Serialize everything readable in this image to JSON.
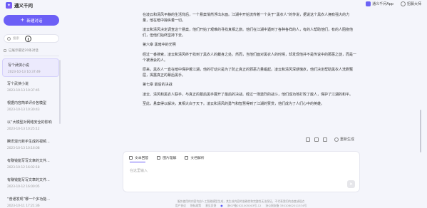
{
  "app": {
    "title": "通义千问",
    "top_links": [
      "通义千问App",
      "招募大师"
    ]
  },
  "sidebar": {
    "new_chat_label": "新建对话",
    "search_placeholder": "搜索",
    "select_hint": "已展示最近20条对话",
    "conversations": [
      {
        "title": "写个武侠小说",
        "date": "2023-10-13 10:37:49",
        "active": true
      },
      {
        "title": "写个武侠小说",
        "date": "2023-10-13 10:37:45",
        "active": false
      },
      {
        "title": "根据内容简单评价各模型",
        "date": "2023-10-13 10:30:43",
        "active": false
      },
      {
        "title": "以“大模型对网络安全的影响",
        "date": "2023-10-13 10:25:12",
        "active": false
      },
      {
        "title": "腾讯混元新手生成的视频...",
        "date": "2023-10-13 10:16:08",
        "active": false
      },
      {
        "title": "有赚钱能写写文章的文件...",
        "date": "2023-10-12 16:02:18",
        "active": false
      },
      {
        "title": "有赚钱能写写文章的文件...",
        "date": "2023-10-12 16:00:05",
        "active": false
      },
      {
        "title": "“普通发现”哪一个多功能...",
        "date": "2023-10-11 17:21:36",
        "active": false
      }
    ]
  },
  "main": {
    "paragraphs": [
      "在凌云和清风平静的生活背后，一个悬案悄然浮出水面。江湖中开始流传着一个关于“黑衣人”的传说，据说这个黑衣人拥有强大的力量，他在暗中操纵着一切。",
      "凌云和清风决定调查这个悬案，他们开始了艰难的寻找真相之旅。他们在江湖中遇到了各种各样的人，有的人帮助他们，有的人阻挠他们，但他们始终坚持下去。",
      "第六章 黑暗中的光明",
      "经过一番搜索，凌云和清风终于找到了黑衣人的藏身之处。然而，当他们面对黑衣人的时候，却发现他并不是传说中的那恶之徒，而是一个被误会的人。",
      "原来，黑衣人一直在暗中保护着江湖，他的行动只是为了防止真正的邪恶力量崛起。凌云和清风深感愧疚，他们决定帮助黑衣人洗刷冤屈，揭露真正的幕后黑手。",
      "第七章 最后的决战",
      "凌云、清风和黑衣人联手，与真正的幕后黑手展开了最后的决战。经过一场激烈的战斗，他们成功地打败了敌人，保护了江湖的和平。",
      "至此，悬案得以解决，真相大白于天下。凌云和清风的勇气和智慧得到了江湖的赞赏，他们成为了人们心中的英雄。"
    ],
    "regenerate_label": "重新生成",
    "input_tabs": [
      "文本回答",
      "图片理解",
      "文档解析"
    ],
    "input_placeholder": "在这里输入",
    "send_icon": "send-icon",
    "footer_disclaimer": "服务使用的内容均由人工智能模型生成，其生成内容的准确性和完整性无法保证，不代表我们的态度或观点",
    "footer_links": [
      "用户协议",
      "隐私政策",
      "意见反馈",
      "浙ICP备2021005003号-12",
      "浙公网安备 33010802011574号"
    ]
  },
  "colors": {
    "accent": "#6c5ff6",
    "background": "#f4f5fb"
  }
}
